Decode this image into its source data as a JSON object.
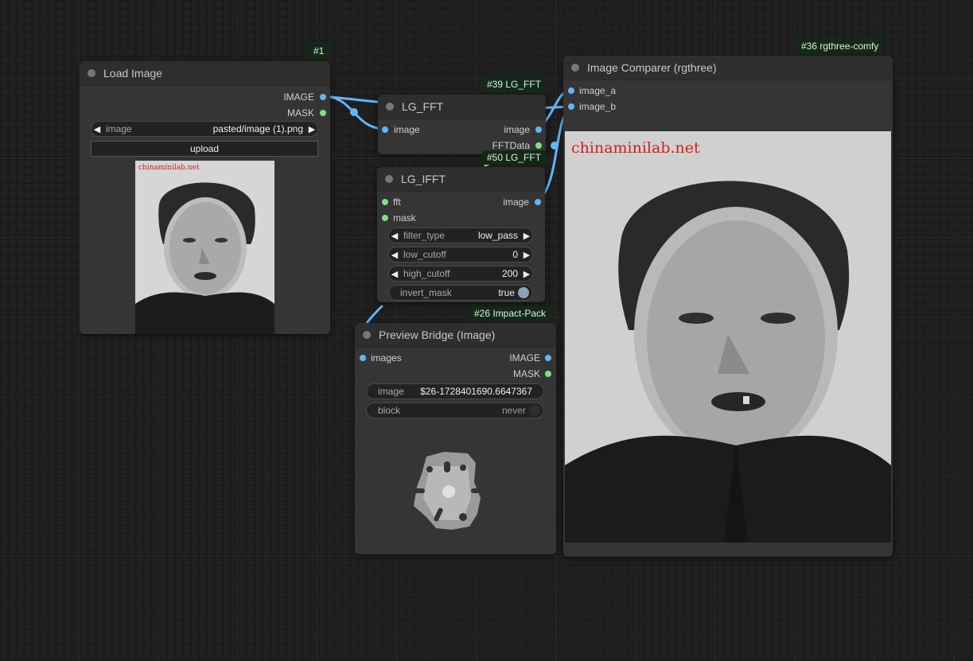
{
  "badges": {
    "load_image": "#1",
    "lg_fft": "#39 LG_FFT",
    "lg_ifft": "#50 LG_FFT",
    "preview_bridge": "#26 Impact-Pack",
    "image_comparer": "#36 rgthree-comfy"
  },
  "load_image": {
    "title": "Load Image",
    "outputs": [
      "IMAGE",
      "MASK"
    ],
    "image_widget": {
      "label": "image",
      "value": "pasted/image (1).png"
    },
    "upload_label": "upload",
    "watermark": "chinaminilab.net"
  },
  "lg_fft": {
    "title": "LG_FFT",
    "inputs": [
      "image"
    ],
    "outputs": [
      "image",
      "FFTData"
    ]
  },
  "lg_ifft": {
    "title": "LG_IFFT",
    "inputs": [
      "fft",
      "mask"
    ],
    "outputs": [
      "image"
    ],
    "widgets": [
      {
        "label": "filter_type",
        "value": "low_pass"
      },
      {
        "label": "low_cutoff",
        "value": "0"
      },
      {
        "label": "high_cutoff",
        "value": "200"
      }
    ],
    "toggle": {
      "label": "invert_mask",
      "value": "true"
    }
  },
  "preview_bridge": {
    "title": "Preview Bridge (Image)",
    "inputs": [
      "images"
    ],
    "outputs": [
      "IMAGE",
      "MASK"
    ],
    "image_widget": {
      "label": "image",
      "value": "$26-1728401690.6647367"
    },
    "block_widget": {
      "label": "block",
      "value": "never"
    }
  },
  "image_comparer": {
    "title": "Image Comparer (rgthree)",
    "inputs": [
      "image_a",
      "image_b"
    ],
    "watermark": "chinaminilab.net"
  },
  "colors": {
    "image_slot": "#64b5f6",
    "mask_slot": "#7fe081",
    "node_body": "#353535",
    "node_title": "#2e2e2e",
    "badge": "#0f2a16"
  },
  "icons": {
    "arrow_left": "left-arrow-icon",
    "arrow_right": "right-arrow-icon",
    "toggle": "toggle-knob-icon"
  }
}
